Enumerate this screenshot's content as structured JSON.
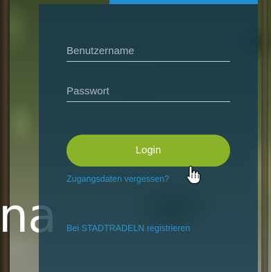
{
  "background": {
    "heading_fragment": "na"
  },
  "login_form": {
    "username_placeholder": "Benutzername",
    "username_value": "",
    "password_placeholder": "Passwort",
    "password_value": "",
    "login_label": "Login",
    "forgot_link": "Zugangsdaten vergessen?",
    "register_link": "Bei STADTRADELN registrieren"
  },
  "colors": {
    "panel": "#143a4e",
    "accent_bar": "#1f8fd0",
    "login_button": "#8ab32a",
    "link": "#2a93d1"
  },
  "icons": {
    "pointer": "hand-pointer-icon"
  }
}
